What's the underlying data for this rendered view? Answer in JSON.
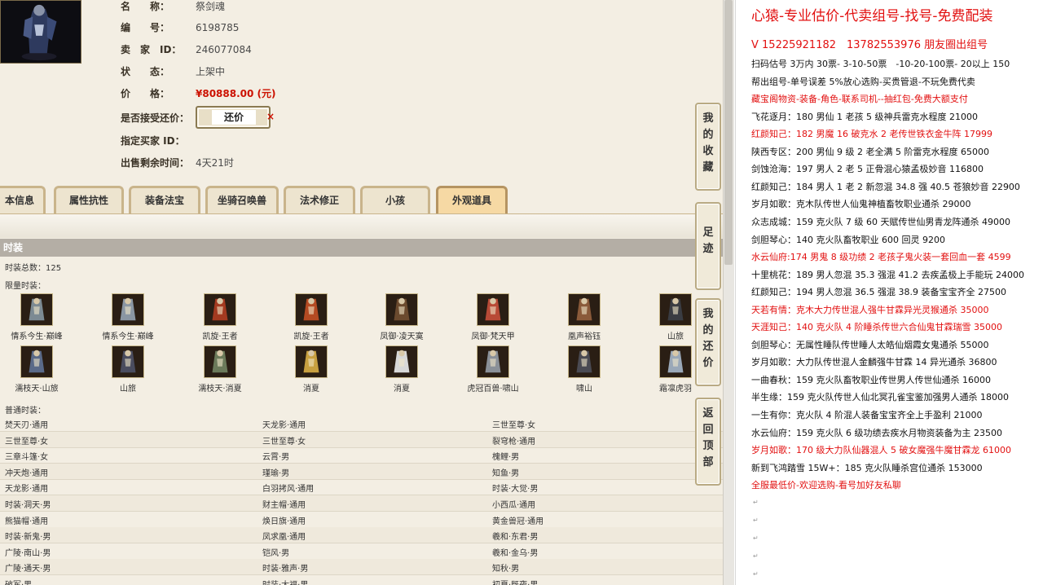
{
  "item_info": {
    "name_label": "名　　称：",
    "name_value": "祭剑魂",
    "id_label": "编　　号：",
    "id_value": "6198785",
    "seller_label": "卖　家　ID：",
    "seller_value": "246077084",
    "status_label": "状　　态：",
    "status_value": "上架中",
    "price_label": "价　　格：",
    "price_value": "¥80888.00 (元)",
    "counter_label": "是否接受还价：",
    "counter_button": "还价",
    "counter_x": "×",
    "buyer_label": "指定买家 ID：",
    "buyer_value": "",
    "remaining_label": "出售剩余时间：",
    "remaining_value": "4天21时"
  },
  "tabs": [
    "本信息",
    "属性抗性",
    "装备法宝",
    "坐骑召唤兽",
    "法术修正",
    "小孩",
    "外观道具"
  ],
  "active_tab": "外观道具",
  "section_title": "时装",
  "fashion_total": "时装总数：125",
  "limited_label": "限量时装：",
  "limited_items": [
    {
      "label": "情系今生·巅峰",
      "icon": "robe-icon",
      "color": "#7c8a93"
    },
    {
      "label": "情系今生·巅峰",
      "icon": "robe-icon",
      "color": "#8a96a3"
    },
    {
      "label": "凯旋·王者",
      "icon": "armor-icon",
      "color": "#a33a20"
    },
    {
      "label": "凯旋·王者",
      "icon": "armor-icon",
      "color": "#b44a22"
    },
    {
      "label": "凤御·凌天寞",
      "icon": "blade-icon",
      "color": "#6b4a2e"
    },
    {
      "label": "凤御·梵天甲",
      "icon": "armor-icon",
      "color": "#b84a36"
    },
    {
      "label": "凰声裕钰",
      "icon": "robe-icon",
      "color": "#8a5a3a"
    },
    {
      "label": "山旅",
      "icon": "hat-icon",
      "color": "#3a3c42"
    },
    {
      "label": "濡枝天·山旅",
      "icon": "robe-icon",
      "color": "#5a6a88"
    },
    {
      "label": "山旅",
      "icon": "robe-icon",
      "color": "#4a4c5e"
    },
    {
      "label": "濡枝天·消夏",
      "icon": "robe-icon",
      "color": "#6b7a5a"
    },
    {
      "label": "消夏",
      "icon": "fan-icon",
      "color": "#c8a040"
    },
    {
      "label": "消夏",
      "icon": "star-icon",
      "color": "#d8d8d8"
    },
    {
      "label": "虎冠百兽·啸山",
      "icon": "robe-icon",
      "color": "#8a9098"
    },
    {
      "label": "啸山",
      "icon": "mask-icon",
      "color": "#4a4a52"
    },
    {
      "label": "霜凛虎羽",
      "icon": "wing-icon",
      "color": "#9aa8b8"
    }
  ],
  "normal_label": "普通时装：",
  "normal_rows": [
    [
      "焚天刃·通用",
      "天龙影·通用",
      "三世至尊·女"
    ],
    [
      "三世至尊·女",
      "三世至尊·女",
      "裂穹枪·通用"
    ],
    [
      "三章斗篷·女",
      "云霄·男",
      "槐鲤·男"
    ],
    [
      "冲天炮·通用",
      "瑾瑜·男",
      "知鱼·男"
    ],
    [
      "天龙影·通用",
      "白羽拷风·通用",
      "时装·大觉·男"
    ],
    [
      "时装·洞天·男",
      "财主帽·通用",
      "小西瓜·通用"
    ],
    [
      "熊猫帽·通用",
      "焕日旗·通用",
      "黄金兽冠·通用"
    ],
    [
      "时装·新鬼·男",
      "凤求凰·通用",
      "羲和·东君·男"
    ],
    [
      "广陵·南山·男",
      "铠风·男",
      "羲和·金乌·男"
    ],
    [
      "广陵·通天·男",
      "时装·雅声·男",
      "知秋·男"
    ],
    [
      "破军·男",
      "时装·大福·男",
      "初夏·既夜·男"
    ]
  ],
  "side_buttons": [
    "我的收藏",
    "足迹",
    "我的还价",
    "返回顶部"
  ],
  "right_panel": {
    "headline": "心猿-专业估价-代卖组号-找号-免费配装",
    "contact": "V 15225921182　13782553976 朋友圈出组号",
    "lines": [
      {
        "text": "扫码估号 3万内 30票- 3-10-50票　-10-20-100票- 20以上 150",
        "red": false
      },
      {
        "text": "帮出组号-单号误差 5%放心选购-买贵管退-不玩免费代卖",
        "red": false
      },
      {
        "text": "藏宝阁物资-装备-角色-联系司机--抽红包-免费大额支付",
        "red": true
      },
      {
        "text": "飞花逐月：180 男仙 1 老孩 5 级神兵雷克水程度 21000",
        "red": false
      },
      {
        "text": "红颜知己：182 男魔 16 破克水 2 老传世铁衣金牛阵 17999",
        "red": true
      },
      {
        "text": "陕西专区：200 男仙 9 级 2 老全满 5 阶雷克水程度 65000",
        "red": false
      },
      {
        "text": "剑蚀沧海：197 男人 2 老 5 正骨混心猿孟极妙音 116800",
        "red": false
      },
      {
        "text": "红颜知己：184 男人 1 老 2 新忽混 34.8 强 40.5 苍狼妙音 22900",
        "red": false
      },
      {
        "text": "岁月如歌：克木队传世人仙鬼神植畜牧职业通杀 29000",
        "red": false
      },
      {
        "text": "众志成城：159 克火队 7 级 60 天赋传世仙男青龙阵通杀 49000",
        "red": false
      },
      {
        "text": "剑胆琴心：140 克火队畜牧职业 600 回灵 9200",
        "red": false
      },
      {
        "text": "水云仙府:174 男鬼 8 级功绩 2 老孩子鬼火装一套回血一套 4599",
        "red": true
      },
      {
        "text": "十里桃花：189 男人忽混 35.3 强混 41.2 去疾孟极上手能玩 24000",
        "red": false
      },
      {
        "text": "红颜知己：194 男人忽混 36.5 强混 38.9 装备宝宝齐全 27500",
        "red": false
      },
      {
        "text": "天若有情：克木大力传世混人强牛甘霖异光灵猴通杀 35000",
        "red": true
      },
      {
        "text": "天涯知己：140 克火队 4 阶睡杀传世六合仙鬼甘霖瑞雪 35000",
        "red": true
      },
      {
        "text": "剑胆琴心：无属性睡队传世睡人太皓仙烟霞女鬼通杀 55000",
        "red": false
      },
      {
        "text": "岁月如歌：大力队传世混人金麟强牛甘霖 14 异光通杀 36800",
        "red": false
      },
      {
        "text": "一曲春秋：159 克火队畜牧职业传世男人传世仙通杀 16000",
        "red": false
      },
      {
        "text": "半生缘：159 克火队传世人仙北冥孔雀宝鉴加强男人通杀 18000",
        "red": false
      },
      {
        "text": "一生有你：克火队 4 阶混人装备宝宝齐全上手盈利 21000",
        "red": false
      },
      {
        "text": "水云仙府：159 克火队 6 级功绩去疾水月物资装备为主 23500",
        "red": false
      },
      {
        "text": "岁月如歌：170 级大力队仙器混人 5 破女魔强牛魔甘霖龙 61000",
        "red": true
      },
      {
        "text": "新到飞鸿踏雪 15W+：185 克火队睡杀宫位通杀 153000",
        "red": false
      },
      {
        "text": "全服最低价-欢迎选购-看号加好友私聊",
        "red": true
      }
    ],
    "paragraph_mark": "↵"
  }
}
